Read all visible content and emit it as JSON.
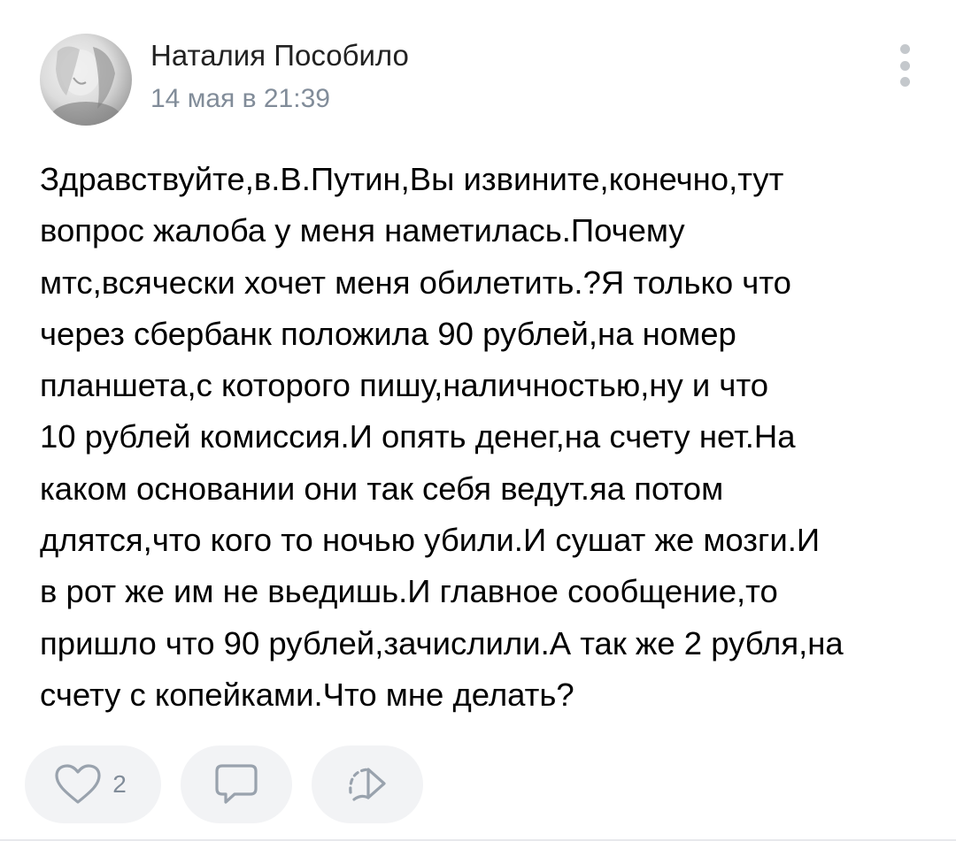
{
  "post": {
    "author": "Наталия Пособило",
    "date": "14 мая в 21:39",
    "text_lines": [
      "Здравствуйте,в.В.Путин,Вы извините,конечно,тут",
      "вопрос жалоба у меня наметилась.Почему",
      "мтс,всячески хочет меня обилетить.?Я только что",
      "через сбербанк положила 90 рублей,на номер",
      "планшета,с которого пишу,наличностью,ну и что",
      "10 рублей комиссия.И опять денег,на счету нет.На",
      "каком основании они так себя ведут.яа потом",
      "длятся,что кого то ночью убили.И сушат же мозги.И",
      "в рот же им не вьедишь.И главное сообщение,то",
      "пришло что 90 рублей,зачислили.А так же 2 рубля,на",
      "счету с копейками.Что мне делать?"
    ]
  },
  "actions": {
    "like_count": "2",
    "like_icon": "heart-outline-icon",
    "comment_icon": "comment-bubble-icon",
    "share_icon": "share-arrow-icon"
  },
  "colors": {
    "name": "#222222",
    "meta": "#818c99",
    "button_bg": "#f2f3f5",
    "icon": "#99a2ad"
  }
}
